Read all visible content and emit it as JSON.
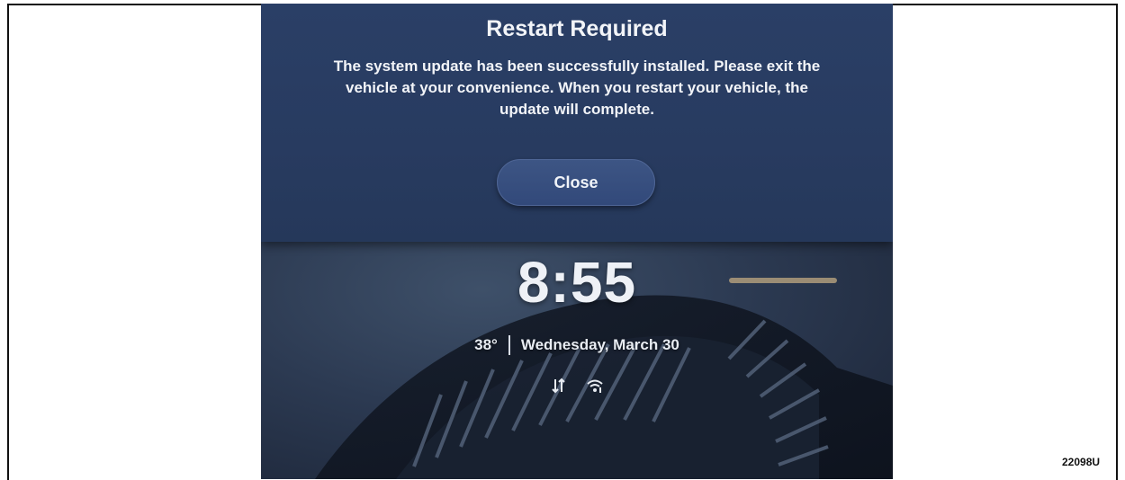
{
  "dialog": {
    "title": "Restart Required",
    "message": "The system update has been successfully installed. Please exit the vehicle at your convenience. When you restart your vehicle, the update will complete.",
    "close_label": "Close"
  },
  "lock_screen": {
    "time": "8:55",
    "temperature": "38°",
    "date": "Wednesday, March 30",
    "icons": [
      "data-transfer-icon",
      "wifi-icon"
    ]
  },
  "figure_code": "22098U",
  "colors": {
    "dialog_bg": "#2a3f66",
    "button_bg": "#3d5584",
    "text": "#f2f4f8"
  }
}
